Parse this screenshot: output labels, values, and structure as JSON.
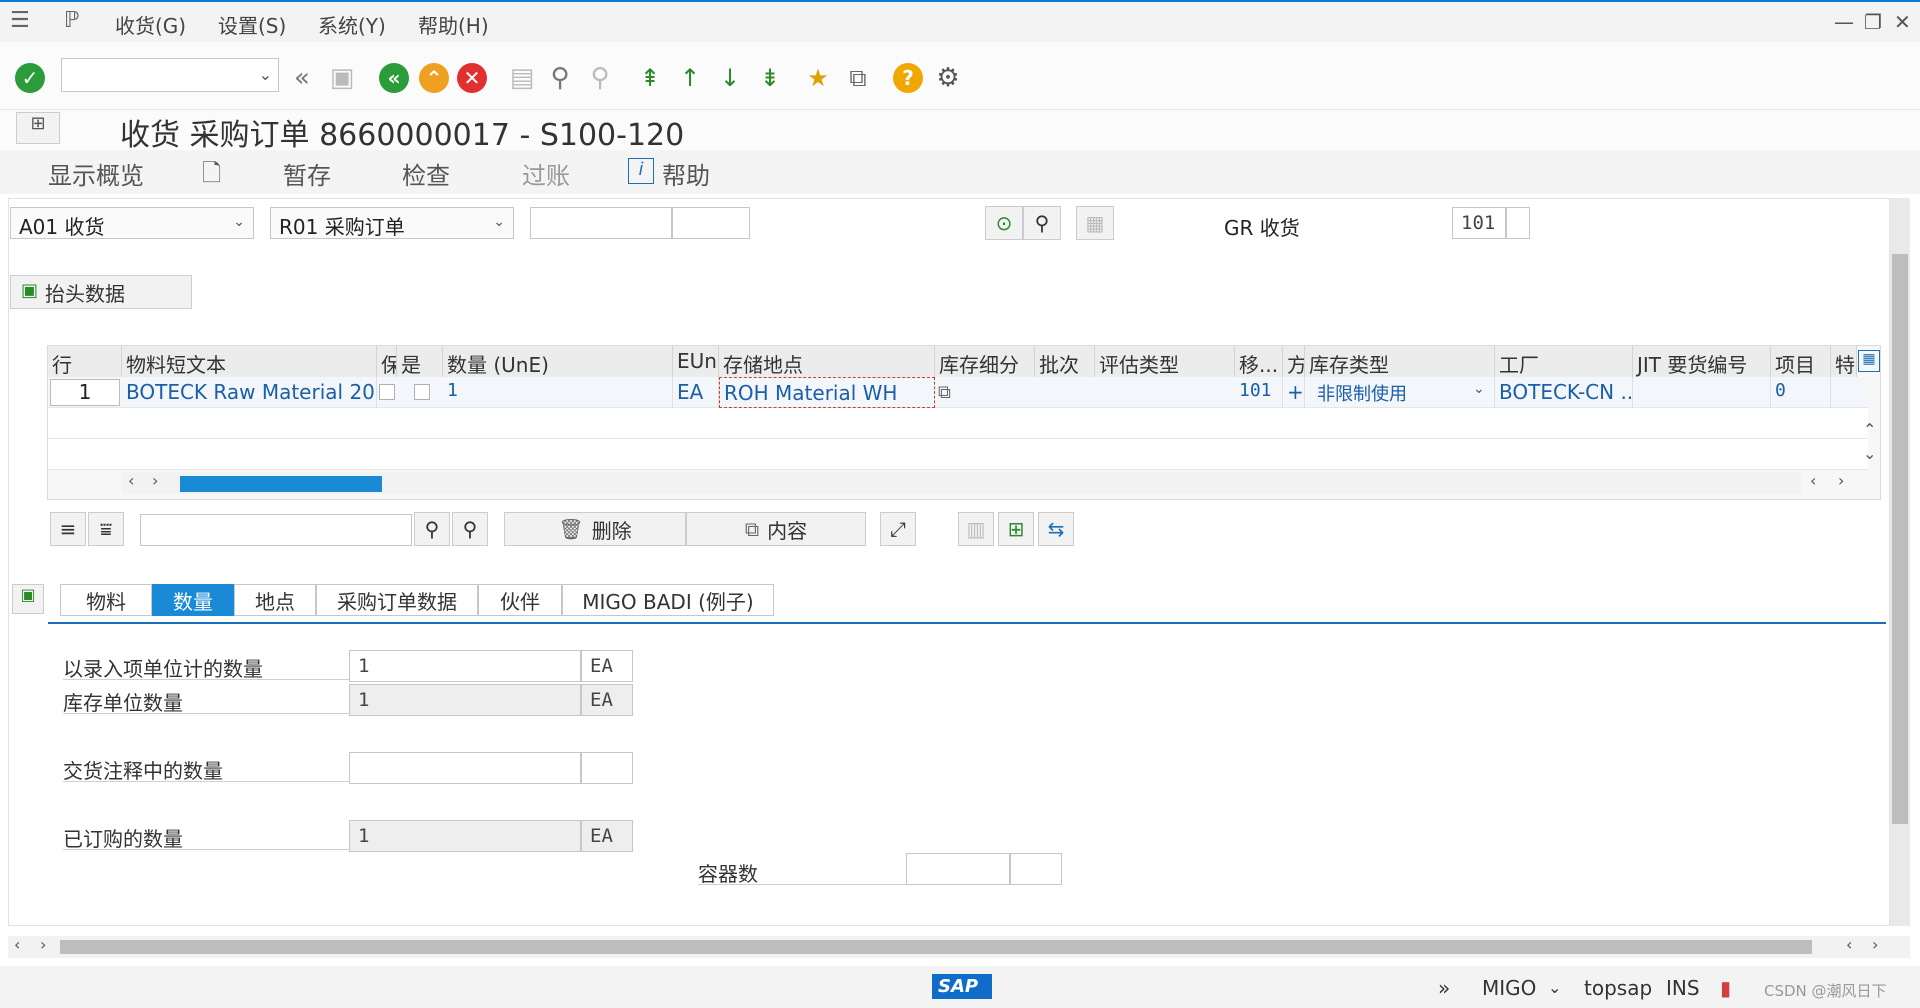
{
  "menubar": {
    "items": [
      "收货(G)",
      "设置(S)",
      "系统(Y)",
      "帮助(H)"
    ]
  },
  "toolbar": {
    "command_field_value": ""
  },
  "title": "收货 采购订单 8660000017 - S100-120",
  "apptoolbar": {
    "overview": "显示概览",
    "hold": "暂存",
    "check": "检查",
    "post": "过账",
    "help": "帮助"
  },
  "selection": {
    "action": "A01 收货",
    "reference": "R01 采购订单",
    "doc_number": "",
    "doc_item": "",
    "gr_label": "GR 收货",
    "movement_type": "101"
  },
  "header_data_button": "抬头数据",
  "grid": {
    "headers": [
      "行",
      "物料短文本",
      "保",
      "是",
      "数量 (UnE)",
      "EUn",
      "存储地点",
      "库存细分",
      "批次",
      "评估类型",
      "移...",
      "方",
      "库存类型",
      "工厂",
      "JIT 要货编号",
      "项目",
      "特"
    ],
    "rows": [
      {
        "line": "1",
        "material_text": "BOTECK Raw Material 20",
        "quantity": "1",
        "unit": "EA",
        "storage_location": "ROH Material WH",
        "movement": "101",
        "direction": "+",
        "stock_type": "非限制使用",
        "plant": "BOTECK-CN ...",
        "item": "0"
      }
    ]
  },
  "grid_toolbar": {
    "search_value": "",
    "delete": "删除",
    "content": "内容"
  },
  "tabs": [
    "物料",
    "数量",
    "地点",
    "采购订单数据",
    "伙伴",
    "MIGO BADI (例子)"
  ],
  "active_tab": "数量",
  "quantity_tab": {
    "entry_qty_label": "以录入项单位计的数量",
    "entry_qty": "1",
    "entry_unit": "EA",
    "stock_qty_label": "库存单位数量",
    "stock_qty": "1",
    "stock_unit": "EA",
    "delivery_note_label": "交货注释中的数量",
    "delivery_note_qty": "",
    "delivery_note_unit": "",
    "ordered_label": "已订购的数量",
    "ordered_qty": "1",
    "ordered_unit": "EA",
    "containers_label": "容器数",
    "containers_value": "",
    "containers_unit": ""
  },
  "statusbar": {
    "brand": "SAP",
    "transaction": "MIGO",
    "server": "topsap",
    "mode": "INS",
    "watermark": "CSDN @潮风日下"
  }
}
